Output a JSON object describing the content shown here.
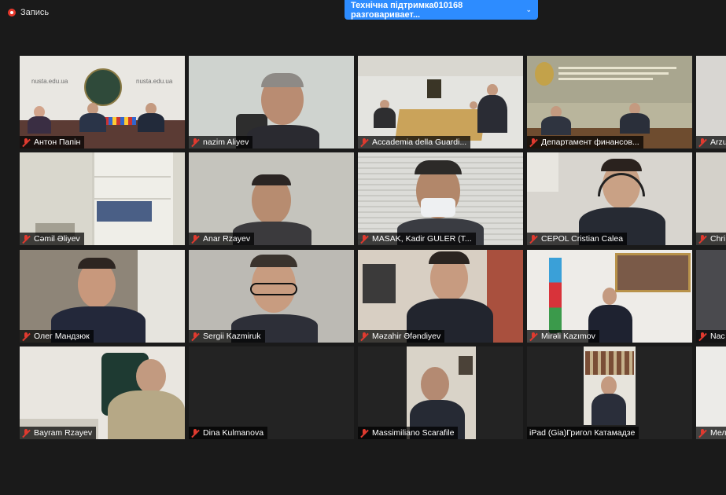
{
  "recording": {
    "label": "Запись"
  },
  "speaking_banner": {
    "text": "Технічна підтримка010168 разговаривает..."
  },
  "tiles": [
    {
      "name": "Антон Папін",
      "muted": true,
      "scene_text_left": "nusta.edu.ua",
      "scene_text_right": "nusta.edu.ua"
    },
    {
      "name": "nazim Aliyev",
      "muted": true
    },
    {
      "name": "Accademia della Guardi...",
      "muted": true
    },
    {
      "name": "Департамент финансов...",
      "muted": true
    },
    {
      "name": "Arzu",
      "muted": true
    },
    {
      "name": "Cəmil Əliyev",
      "muted": true
    },
    {
      "name": "Anar Rzayev",
      "muted": true
    },
    {
      "name": "MASAK, Kadir GULER (T...",
      "muted": true
    },
    {
      "name": "CEPOL Cristian Calea",
      "muted": true
    },
    {
      "name": "Chri",
      "muted": true
    },
    {
      "name": "Олег Мандзюк",
      "muted": true
    },
    {
      "name": "Sergii Kazmiruk",
      "muted": true
    },
    {
      "name": "Məzahir Əfəndiyev",
      "muted": true
    },
    {
      "name": "Mirəli Kazımov",
      "muted": true
    },
    {
      "name": "Nac",
      "muted": true
    },
    {
      "name": "Bayram Rzayev",
      "muted": true
    },
    {
      "name": "Dina Kulmanova",
      "muted": true
    },
    {
      "name": "Massimiliano Scarafile",
      "muted": true
    },
    {
      "name": "iPad (Gia)Григол Катамадзе",
      "muted": false
    },
    {
      "name": "Мел",
      "muted": true
    }
  ],
  "colors": {
    "background": "#1a1a1a",
    "banner": "#2d8cff",
    "muted_mic": "#e03a2f"
  }
}
